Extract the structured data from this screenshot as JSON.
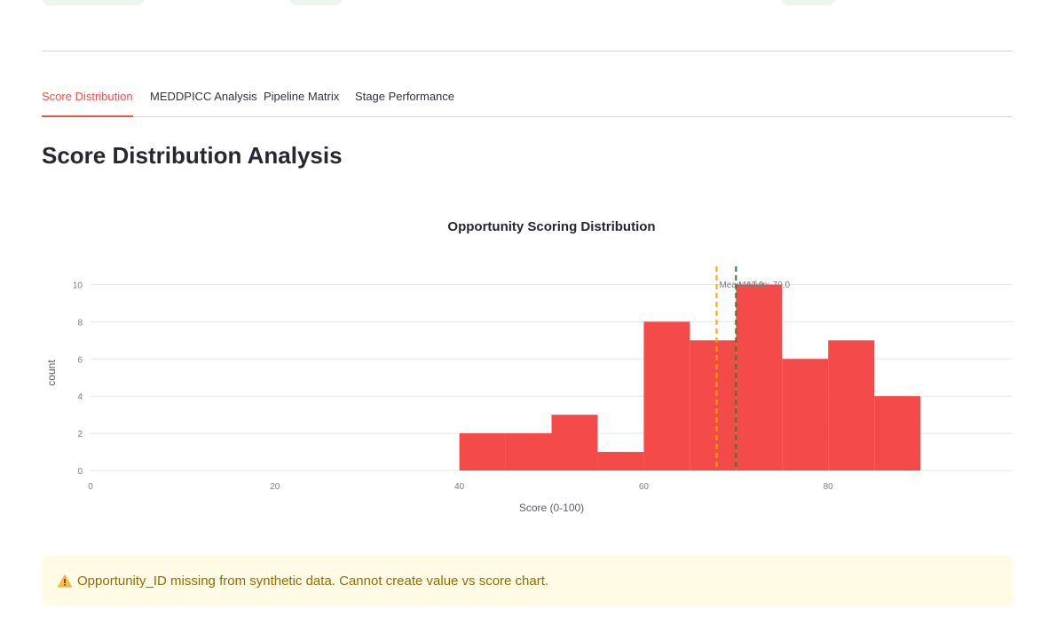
{
  "tabs": [
    {
      "label": "Score Distribution",
      "active": true
    },
    {
      "label": "MEDDPICC Analysis",
      "active": false
    },
    {
      "label": "Pipeline Matrix",
      "active": false
    },
    {
      "label": "Stage Performance",
      "active": false
    }
  ],
  "section_title": "Score Distribution Analysis",
  "chart_data": {
    "type": "bar",
    "title": "Opportunity Scoring Distribution",
    "xlabel": "Score (0-100)",
    "ylabel": "count",
    "xlim": [
      0,
      100
    ],
    "ylim": [
      0,
      10.5
    ],
    "x_ticks": [
      0,
      20,
      40,
      60,
      80
    ],
    "y_ticks": [
      0,
      2,
      4,
      6,
      8,
      10
    ],
    "bins": [
      {
        "start": 40,
        "end": 45,
        "count": 2
      },
      {
        "start": 45,
        "end": 50,
        "count": 2
      },
      {
        "start": 50,
        "end": 55,
        "count": 3
      },
      {
        "start": 55,
        "end": 60,
        "count": 1
      },
      {
        "start": 60,
        "end": 65,
        "count": 8
      },
      {
        "start": 65,
        "end": 70,
        "count": 7
      },
      {
        "start": 70,
        "end": 75,
        "count": 10
      },
      {
        "start": 75,
        "end": 80,
        "count": 6
      },
      {
        "start": 80,
        "end": 85,
        "count": 7
      },
      {
        "start": 85,
        "end": 90,
        "count": 4
      }
    ],
    "bar_color": "#f54a4a",
    "lines": [
      {
        "label": "Mean: 67.9",
        "x": 67.9,
        "color": "#ffa500"
      },
      {
        "label": "Median: 70.0",
        "x": 70.0,
        "color": "#228b22"
      }
    ],
    "grid": true
  },
  "alert": {
    "icon": "warning-icon",
    "text": "Opportunity_ID missing from synthetic data. Cannot create value vs score chart."
  }
}
